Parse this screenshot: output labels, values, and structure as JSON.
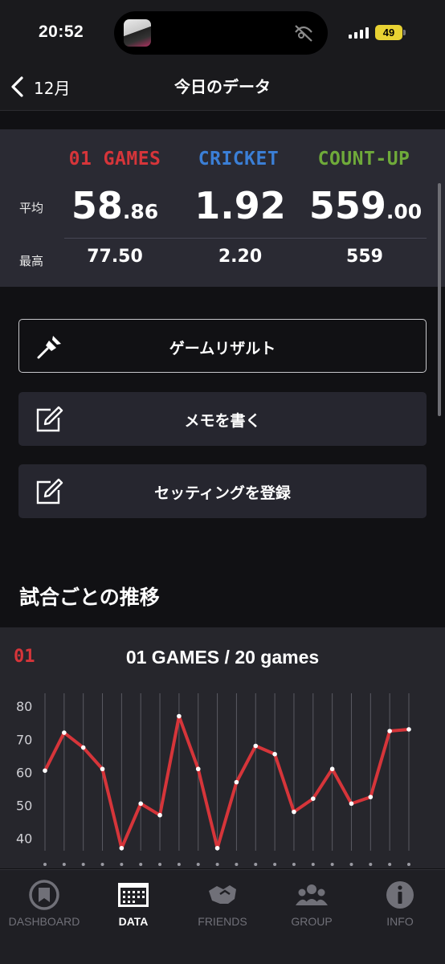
{
  "status": {
    "time": "20:52",
    "battery": "49"
  },
  "nav": {
    "back_label": "12月",
    "title": "今日のデータ"
  },
  "stats": {
    "columns": [
      {
        "name": "01 GAMES",
        "avg_int": "58",
        "avg_dec": ".86",
        "max": "77.50"
      },
      {
        "name": "CRICKET",
        "avg_int": "1.92",
        "avg_dec": "",
        "max": "2.20"
      },
      {
        "name": "COUNT-UP",
        "avg_int": "559",
        "avg_dec": ".00",
        "max": "559"
      }
    ],
    "avg_label": "平均",
    "max_label": "最高",
    "colors": {
      "games01": "#d6353a",
      "cricket": "#3b7fd6",
      "countup": "#6faa3a"
    }
  },
  "actions": [
    {
      "label": "ゲームリザルト",
      "icon": "dart-icon"
    },
    {
      "label": "メモを書く",
      "icon": "edit-note-icon"
    },
    {
      "label": "セッティングを登録",
      "icon": "edit-note-icon"
    }
  ],
  "section_title": "試合ごとの推移",
  "chart": {
    "badge": "01",
    "title": "01 GAMES / 20 games"
  },
  "chart_data": {
    "type": "line",
    "x": [
      1,
      2,
      3,
      4,
      5,
      6,
      7,
      8,
      9,
      10,
      11,
      12,
      13,
      14,
      15,
      16,
      17,
      18,
      19,
      20
    ],
    "series": [
      {
        "values": [
          60.5,
          72,
          67.5,
          61,
          37,
          50.5,
          47,
          77,
          61,
          37,
          57,
          68,
          65.5,
          48,
          52,
          61,
          50.5,
          52.5,
          72.5,
          73
        ]
      }
    ],
    "yticks": [
      80,
      70,
      60,
      50,
      40
    ],
    "ylim": [
      35,
      82
    ],
    "grid": "vertical",
    "line_color": "#d6353a"
  },
  "tabs": [
    {
      "label": "DASHBOARD",
      "icon": "dashboard-icon"
    },
    {
      "label": "DATA",
      "icon": "data-icon"
    },
    {
      "label": "FRIENDS",
      "icon": "friends-icon"
    },
    {
      "label": "GROUP",
      "icon": "group-icon"
    },
    {
      "label": "INFO",
      "icon": "info-icon"
    }
  ],
  "active_tab": "DATA"
}
